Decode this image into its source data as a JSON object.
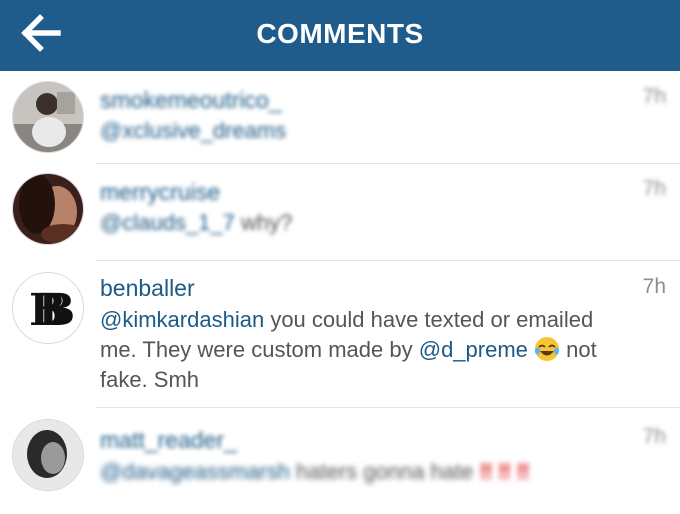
{
  "header": {
    "title": "COMMENTS",
    "back_icon": "arrow-left-icon",
    "background": "#1f5c8c"
  },
  "comments": [
    {
      "username": "smokemeoutrico_",
      "time": "7h",
      "mention": "@xclusive_dreams",
      "text": ""
    },
    {
      "username": "merrycruise",
      "time": "7h",
      "mention": "@clauds_1_7",
      "text": "why?"
    },
    {
      "username": "benballer",
      "time": "7h",
      "mention": "@kimkardashian",
      "text": "you could have texted or emailed me. They were custom made by",
      "mention2": "@d_preme",
      "emoji": "tears-of-joy-emoji",
      "text2": "not fake. Smh"
    },
    {
      "username": "matt_reader_",
      "time": "7h",
      "mention": "@davageassmarsh",
      "text": "haters gonna hate",
      "bangs": [
        "‼",
        "‼",
        "‼"
      ]
    }
  ],
  "colors": {
    "username": "#1d5a86",
    "text": "#555555",
    "time": "#8e8e8e",
    "exclamation": "#e0262b"
  }
}
